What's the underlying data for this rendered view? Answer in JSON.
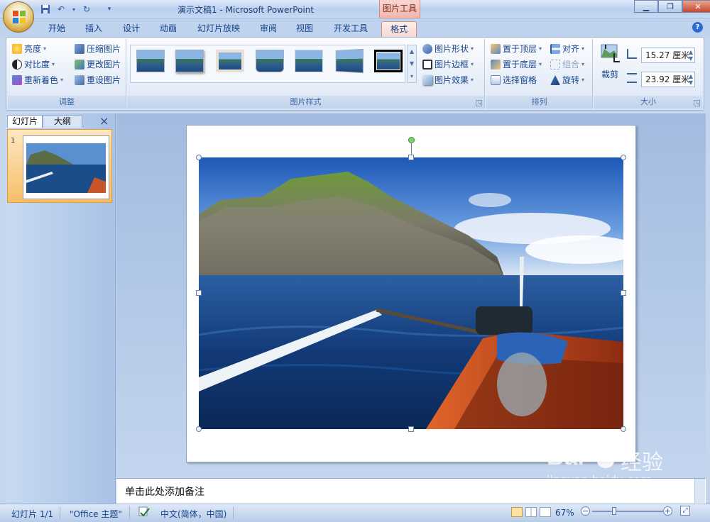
{
  "window": {
    "title": "演示文稿1 - Microsoft PowerPoint",
    "context_tab": "图片工具"
  },
  "tabs": [
    {
      "label": "开始"
    },
    {
      "label": "插入"
    },
    {
      "label": "设计"
    },
    {
      "label": "动画"
    },
    {
      "label": "幻灯片放映"
    },
    {
      "label": "审阅"
    },
    {
      "label": "视图"
    },
    {
      "label": "开发工具"
    },
    {
      "label": "格式",
      "active": true
    }
  ],
  "ribbon": {
    "adjust": {
      "label": "调整",
      "brightness": "亮度",
      "contrast": "对比度",
      "recolor": "重新着色",
      "compress": "压缩图片",
      "change_picture": "更改图片",
      "reset_picture": "重设图片"
    },
    "picture_styles": {
      "label": "图片样式",
      "shape": "图片形状",
      "border": "图片边框",
      "effects": "图片效果"
    },
    "arrange": {
      "label": "排列",
      "bring_front": "置于顶层",
      "send_back": "置于底层",
      "selection_pane": "选择窗格",
      "align": "对齐",
      "group": "组合",
      "rotate": "旋转"
    },
    "size": {
      "label": "大小",
      "crop": "裁剪",
      "height": "15.27 厘米",
      "width": "23.92 厘米"
    }
  },
  "panel": {
    "tab_slides": "幻灯片",
    "tab_outline": "大纲",
    "close": "×",
    "slide_number": "1"
  },
  "notes": {
    "placeholder": "单击此处添加备注"
  },
  "status": {
    "slide": "幻灯片 1/1",
    "theme": "\"Office 主题\"",
    "language": "中文(简体，中国)",
    "zoom": "67%"
  },
  "watermark": {
    "brand": "Bai",
    "brand2": "经验",
    "url": "jingyan.baidu.com"
  },
  "colors": {
    "ribbon_bg": "#e4ecf7",
    "active_tab": "#f6d7d1",
    "accent": "#15428b"
  }
}
